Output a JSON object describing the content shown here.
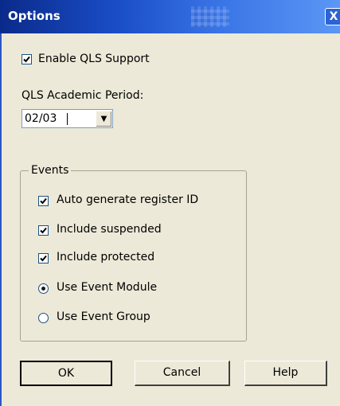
{
  "window": {
    "title": "Options",
    "close_glyph": "X"
  },
  "enable_qls": {
    "label": "Enable QLS Support",
    "checked": true
  },
  "academic_period": {
    "label": "QLS Academic Period:",
    "value": "02/03",
    "arrow_glyph": "▼"
  },
  "events": {
    "title": "Events",
    "options": [
      {
        "type": "checkbox",
        "label": "Auto generate register ID",
        "checked": true
      },
      {
        "type": "checkbox",
        "label": "Include suspended",
        "checked": true
      },
      {
        "type": "checkbox",
        "label": "Include protected",
        "checked": true
      },
      {
        "type": "radio",
        "label": "Use Event Module",
        "checked": true
      },
      {
        "type": "radio",
        "label": "Use Event Group",
        "checked": false
      }
    ]
  },
  "buttons": {
    "ok": "OK",
    "cancel": "Cancel",
    "help": "Help"
  },
  "colors": {
    "titlebar_start": "#0a2a8a",
    "titlebar_end": "#5b97f5",
    "dialog_bg": "#ece9d8"
  }
}
